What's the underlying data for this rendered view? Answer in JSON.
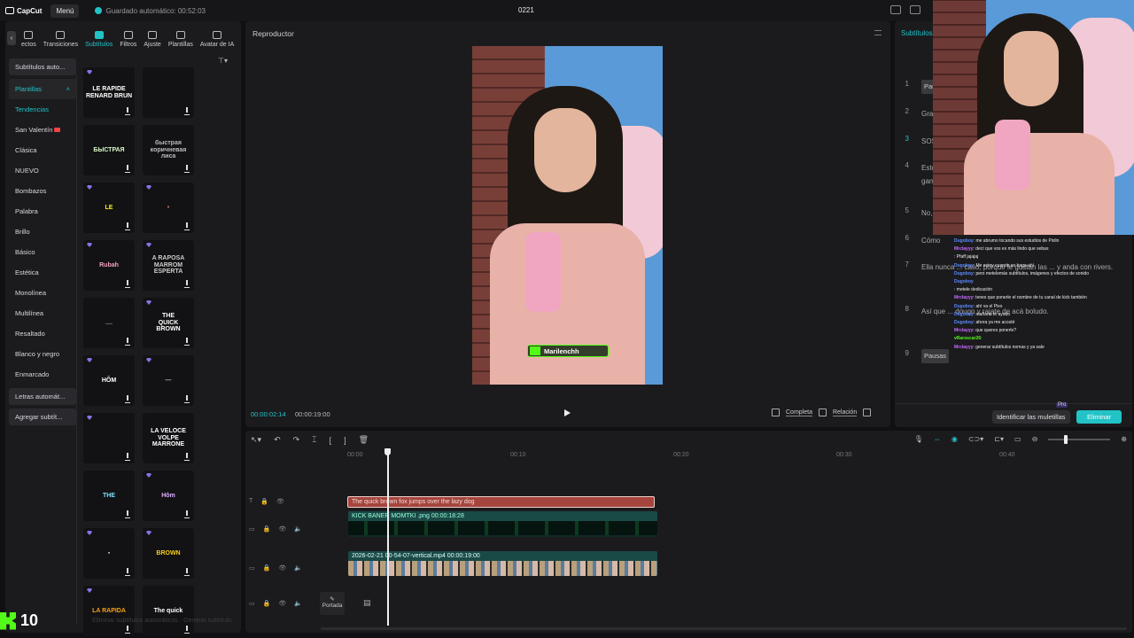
{
  "topbar": {
    "logo": "CapCut",
    "menu_label": "Menú",
    "autosave": "Guardado automático: 00:52:03",
    "project_title": "0221"
  },
  "tool_tabs": [
    {
      "label": "ectos",
      "name": "tab-efectos"
    },
    {
      "label": "Transiciones",
      "name": "tab-transiciones"
    },
    {
      "label": "Subtítulos",
      "name": "tab-subtitulos",
      "active": true
    },
    {
      "label": "Filtros",
      "name": "tab-filtros"
    },
    {
      "label": "Ajuste",
      "name": "tab-ajuste"
    },
    {
      "label": "Plantillas",
      "name": "tab-plantillas"
    },
    {
      "label": "Avatar de IA",
      "name": "tab-avatar-ia"
    }
  ],
  "categories": [
    {
      "label": "Subtítulos auto...",
      "style": "boxed"
    },
    {
      "label": "Plantillas",
      "style": "sel"
    },
    {
      "label": "Tendencias",
      "style": "teal"
    },
    {
      "label": "San Valentín",
      "style": "heart"
    },
    {
      "label": "Clásica"
    },
    {
      "label": "NUEVO"
    },
    {
      "label": "Bombazos"
    },
    {
      "label": "Palabra"
    },
    {
      "label": "Brillo"
    },
    {
      "label": "Básico"
    },
    {
      "label": "Estética"
    },
    {
      "label": "Monolínea"
    },
    {
      "label": "Multilínea"
    },
    {
      "label": "Resaltado"
    },
    {
      "label": "Blanco y negro"
    },
    {
      "label": "Enmarcado"
    },
    {
      "label": "Letras automát...",
      "style": "boxed"
    },
    {
      "label": "Agregar subtít...",
      "style": "boxed"
    }
  ],
  "templates": [
    {
      "text": "LE RAPIDE\nRENARD BRUN",
      "color": "#ffffff",
      "pro": true
    },
    {
      "text": "",
      "color": "#ffffff",
      "pro": false
    },
    {
      "text": "БЫСТРАЯ",
      "color": "#d7f5c6",
      "pro": false
    },
    {
      "text": "быстрая коричневая лиса",
      "color": "#bbbbbb",
      "pro": false
    },
    {
      "text": "LE",
      "color": "#f5f519",
      "pro": true
    },
    {
      "text": "•",
      "color": "#d66",
      "pro": true
    },
    {
      "text": "Rubah",
      "color": "#f2a0c0",
      "pro": true
    },
    {
      "text": "A RAPOSA MARROM ESPERTA",
      "color": "#cccccc",
      "pro": true
    },
    {
      "text": "....",
      "color": "#999999",
      "pro": false
    },
    {
      "text": "THE\nQUICK\nBROWN",
      "color": "#ffffff",
      "pro": true
    },
    {
      "text": "HÔM",
      "color": "#ffffff",
      "pro": true
    },
    {
      "text": "—",
      "color": "#bbbbbb",
      "pro": true
    },
    {
      "text": "",
      "color": "#ffffff",
      "pro": true
    },
    {
      "text": "LA VELOCE\nVOLPE MARRONE",
      "color": "#ffffff",
      "pro": false
    },
    {
      "text": "THE",
      "color": "#7fe3ff",
      "pro": false
    },
    {
      "text": "Hôm",
      "color": "#e0b0ff",
      "pro": true
    },
    {
      "text": "▪",
      "color": "#bbbbbb",
      "pro": true
    },
    {
      "text": "BROWN",
      "color": "#f5d019",
      "pro": true
    },
    {
      "text": "LA RAPIDA",
      "color": "#f5a019",
      "pro": true
    },
    {
      "text": "The quick",
      "color": "#ffffff",
      "pro": false
    }
  ],
  "left_bottom": {
    "kick_count": "10",
    "hint": "Eliminar subtítulos automáticos · Generar subtítulo"
  },
  "player": {
    "title": "Reproductor",
    "name_tag": "Marilenchh",
    "time_current": "00:00:02:14",
    "time_total": "00:00:19:00",
    "completa": "Completa",
    "relacion": "Relación"
  },
  "subtitles_panel": {
    "title": "Subtítulos",
    "rows": [
      {
        "num": "1",
        "text": "Pausas",
        "pause": true
      },
      {
        "num": "2",
        "text": "Grac"
      },
      {
        "num": "3",
        "text": "SOS",
        "active": true
      },
      {
        "num": "4",
        "text": "Esto\ngam"
      },
      {
        "num": "5",
        "text": "No,"
      },
      {
        "num": "6",
        "text": "Cómo"
      },
      {
        "num": "7",
        "text": "Ella nunca ... caso, porque le gustan las ... y anda con rivers."
      },
      {
        "num": "8",
        "text": "Así que ... dougo y rajate de acá boludo."
      },
      {
        "num": "9",
        "text": "Pausas",
        "pause": true
      }
    ],
    "identify_label": "Identificar las muletillas",
    "pro_label": "Pro",
    "delete_label": "Eliminar"
  },
  "chat": [
    {
      "user": "Dugoboy",
      "msg": ": me abrumo tocando sus estudios de Pixlin",
      "color": "#5b8cff"
    },
    {
      "user": "Mrclayyy",
      "msg": ": decí que vos es más lindo que sebas",
      "color": "#c86bff"
    },
    {
      "user": "",
      "msg": ": Pfaff jajajaj",
      "color": "#ff5f5f"
    },
    {
      "user": "Dugoboy",
      "msg": ": Me estoy cuando se haga ahí",
      "color": "#5b8cff"
    },
    {
      "user": "Dugoboy",
      "msg": ": pero metelemás subtítulos, imágenes y efectos de sonido",
      "color": "#5b8cff"
    },
    {
      "user": "Dugoboy",
      "msg": "",
      "color": "#5b8cff"
    },
    {
      "user": "",
      "msg": ": metele dedicación",
      "color": "#ff5f5f"
    },
    {
      "user": "",
      "msg": "",
      "color": "#53fc18"
    },
    {
      "user": "Mrclayyy",
      "msg": ": tenes que ponerle el nombre de tu canal de kick también",
      "color": "#c86bff"
    },
    {
      "user": "Dugoboy",
      "msg": ": ahí va el Pixo",
      "color": "#5b8cff"
    },
    {
      "user": "Dugoboy",
      "msg": ": mañana te ayudo",
      "color": "#5b8cff"
    },
    {
      "user": "Dugoboy",
      "msg": ": ahora ya me acosté",
      "color": "#5b8cff"
    },
    {
      "user": "Mrclayyy",
      "msg": ": que queres ponerle?",
      "color": "#c86bff"
    },
    {
      "user": "vRaroscar26",
      "msg": ":",
      "color": "#53fc18"
    },
    {
      "user": "Mrclayyy",
      "msg": ": generar subtítulos nomas y ya sale",
      "color": "#c86bff"
    }
  ],
  "timeline": {
    "ruler": [
      {
        "label": "00:00",
        "pos": 0
      },
      {
        "label": "00:10",
        "pos": 1
      },
      {
        "label": "00:20",
        "pos": 2
      },
      {
        "label": "00:30",
        "pos": 3
      },
      {
        "label": "00:40",
        "pos": 4
      }
    ],
    "text_clip": "The quick brown fox jumps over the lazy dog",
    "clip_a": "KICK BANER MOMTKI .png  00:00:18:28",
    "clip_b": "2026-02-21 00-54-07-vertical.mp4  00:00:19:00",
    "portada": "Portada"
  },
  "colors": {
    "accent": "#22c3c6",
    "kick": "#53fc18",
    "delete": "#22c3c6"
  }
}
